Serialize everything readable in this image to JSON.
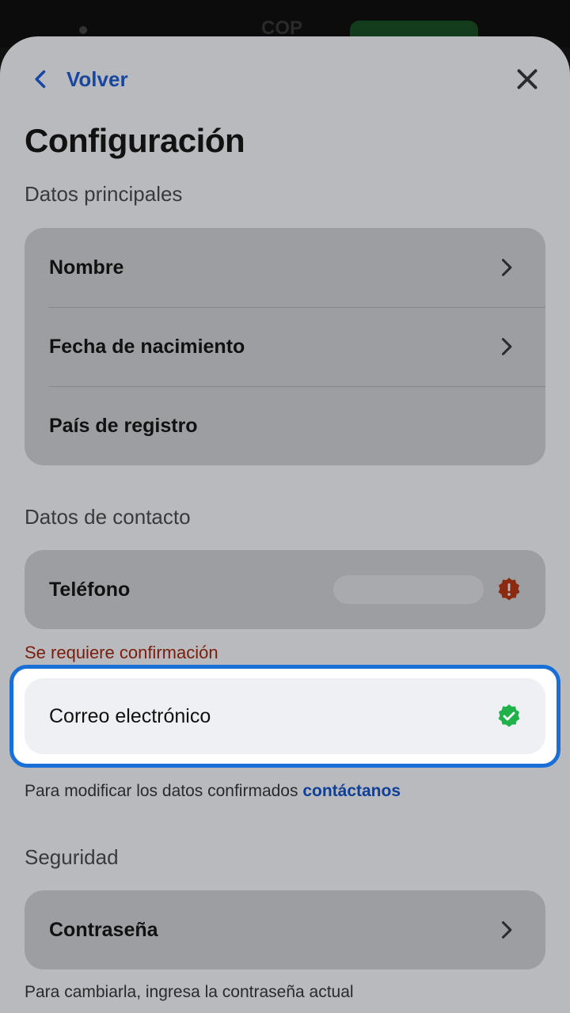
{
  "statusbar": {
    "currency": "COP"
  },
  "nav": {
    "back_label": "Volver"
  },
  "page": {
    "title": "Configuración"
  },
  "sections": {
    "main": {
      "heading": "Datos principales",
      "items": [
        {
          "label": "Nombre"
        },
        {
          "label": "Fecha de nacimiento"
        },
        {
          "label": "País de registro"
        }
      ]
    },
    "contact": {
      "heading": "Datos de contacto",
      "phone_label": "Teléfono",
      "phone_warning": "Se requiere confirmación",
      "email_label": "Correo electrónico",
      "note_text": "Para modificar los datos confirmados ",
      "note_link": "contáctanos"
    },
    "security": {
      "heading": "Seguridad",
      "password_label": "Contraseña",
      "note_text": "Para cambiarla, ingresa la contraseña actual"
    }
  },
  "colors": {
    "accent": "#1747a0",
    "highlight": "#1a6fd6",
    "warning": "#7a1d0c",
    "success": "#1fb24a"
  },
  "icons": {
    "back": "chevron-left-icon",
    "close": "close-icon",
    "row": "chevron-right-icon",
    "phone_status": "alert-badge-icon",
    "email_status": "verified-badge-icon"
  }
}
